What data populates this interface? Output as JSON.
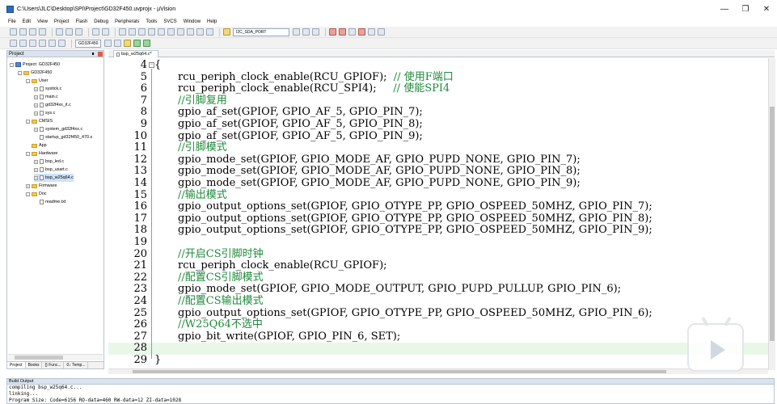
{
  "window": {
    "title": "C:\\Users\\JLC\\Desktop\\SPI\\Project\\GD32F450.uvprojx - µVision"
  },
  "menu": [
    "File",
    "Edit",
    "View",
    "Project",
    "Flash",
    "Debug",
    "Peripherals",
    "Tools",
    "SVCS",
    "Window",
    "Help"
  ],
  "toolbar": {
    "find_combo": "I2C_SDA_PORT",
    "target_combo": "GD32F450"
  },
  "project_panel": {
    "title": "Project",
    "tree": [
      {
        "label": "Project: GD32F450",
        "depth": 0,
        "kind": "project",
        "exp": "-"
      },
      {
        "label": "GD32F450",
        "depth": 1,
        "kind": "folder",
        "exp": "-"
      },
      {
        "label": "User",
        "depth": 2,
        "kind": "folder",
        "exp": "-"
      },
      {
        "label": "systick.c",
        "depth": 3,
        "kind": "file",
        "exp": "+"
      },
      {
        "label": "main.c",
        "depth": 3,
        "kind": "file",
        "exp": "+"
      },
      {
        "label": "gd32f4xx_it.c",
        "depth": 3,
        "kind": "file",
        "exp": "+"
      },
      {
        "label": "sys.c",
        "depth": 3,
        "kind": "file",
        "exp": "+"
      },
      {
        "label": "CMSIS",
        "depth": 2,
        "kind": "folder",
        "exp": "-"
      },
      {
        "label": "system_gd32f4xx.c",
        "depth": 3,
        "kind": "file",
        "exp": "+"
      },
      {
        "label": "startup_gd32f450_470.s",
        "depth": 3,
        "kind": "file",
        "exp": ""
      },
      {
        "label": "App",
        "depth": 2,
        "kind": "folder",
        "exp": ""
      },
      {
        "label": "Hardware",
        "depth": 2,
        "kind": "folder",
        "exp": "-"
      },
      {
        "label": "bsp_led.c",
        "depth": 3,
        "kind": "file",
        "exp": "+"
      },
      {
        "label": "bsp_usart.c",
        "depth": 3,
        "kind": "file",
        "exp": "+"
      },
      {
        "label": "bsp_w25q64.c",
        "depth": 3,
        "kind": "file",
        "exp": "+",
        "selected": true
      },
      {
        "label": "Firmware",
        "depth": 2,
        "kind": "folder",
        "exp": "+"
      },
      {
        "label": "Doc",
        "depth": 2,
        "kind": "folder",
        "exp": "-"
      },
      {
        "label": "readme.txt",
        "depth": 3,
        "kind": "file",
        "exp": ""
      }
    ],
    "tabs": [
      "Project",
      "Books",
      "{} Func...",
      "0↓ Temp..."
    ]
  },
  "editor": {
    "tab_label": "bsp_w25q64.c*",
    "lines": [
      {
        "n": "4",
        "code": "{",
        "comment": "",
        "first": true
      },
      {
        "n": "5",
        "code": "rcu_periph_clock_enable(RCU_GPIOF);  ",
        "comment": "// 使用F端口"
      },
      {
        "n": "6",
        "code": "rcu_periph_clock_enable(RCU_SPI4);     ",
        "comment": "// 使能SPI4"
      },
      {
        "n": "7",
        "code": "",
        "comment": "//引脚复用"
      },
      {
        "n": "8",
        "code": "gpio_af_set(GPIOF, GPIO_AF_5, GPIO_PIN_7);",
        "comment": ""
      },
      {
        "n": "9",
        "code": "gpio_af_set(GPIOF, GPIO_AF_5, GPIO_PIN_8);",
        "comment": ""
      },
      {
        "n": "10",
        "code": "gpio_af_set(GPIOF, GPIO_AF_5, GPIO_PIN_9);",
        "comment": ""
      },
      {
        "n": "11",
        "code": "",
        "comment": "//引脚模式"
      },
      {
        "n": "12",
        "code": "gpio_mode_set(GPIOF, GPIO_MODE_AF, GPIO_PUPD_NONE, GPIO_PIN_7);",
        "comment": ""
      },
      {
        "n": "13",
        "code": "gpio_mode_set(GPIOF, GPIO_MODE_AF, GPIO_PUPD_NONE, GPIO_PIN_8);",
        "comment": ""
      },
      {
        "n": "14",
        "code": "gpio_mode_set(GPIOF, GPIO_MODE_AF, GPIO_PUPD_NONE, GPIO_PIN_9);",
        "comment": ""
      },
      {
        "n": "15",
        "code": "",
        "comment": "//输出模式"
      },
      {
        "n": "16",
        "code": "gpio_output_options_set(GPIOF, GPIO_OTYPE_PP, GPIO_OSPEED_50MHZ, GPIO_PIN_7);",
        "comment": ""
      },
      {
        "n": "17",
        "code": "gpio_output_options_set(GPIOF, GPIO_OTYPE_PP, GPIO_OSPEED_50MHZ, GPIO_PIN_8);",
        "comment": ""
      },
      {
        "n": "18",
        "code": "gpio_output_options_set(GPIOF, GPIO_OTYPE_PP, GPIO_OSPEED_50MHZ, GPIO_PIN_9);",
        "comment": ""
      },
      {
        "n": "19",
        "code": "",
        "comment": ""
      },
      {
        "n": "20",
        "code": "",
        "comment": "//开启CS引脚时钟"
      },
      {
        "n": "21",
        "code": "rcu_periph_clock_enable(RCU_GPIOF);",
        "comment": ""
      },
      {
        "n": "22",
        "code": "",
        "comment": "//配置CS引脚模式"
      },
      {
        "n": "23",
        "code": "gpio_mode_set(GPIOF, GPIO_MODE_OUTPUT, GPIO_PUPD_PULLUP, GPIO_PIN_6);",
        "comment": ""
      },
      {
        "n": "24",
        "code": "",
        "comment": "//配置CS输出模式"
      },
      {
        "n": "25",
        "code": "gpio_output_options_set(GPIOF, GPIO_OTYPE_PP, GPIO_OSPEED_50MHZ, GPIO_PIN_6);",
        "comment": ""
      },
      {
        "n": "26",
        "code": "",
        "comment": "//W25Q64不选中"
      },
      {
        "n": "27",
        "code": "gpio_bit_write(GPIOF, GPIO_PIN_6, SET);",
        "comment": ""
      },
      {
        "n": "28",
        "code": "",
        "comment": "",
        "current": true
      },
      {
        "n": "29",
        "code": "}",
        "comment": "",
        "first": true
      }
    ]
  },
  "build_output": {
    "title": "Build Output",
    "lines": [
      "compiling bsp_w25q64.c...",
      "linking...",
      "Program Size: Code=6156 RO-data=460 RW-data=12 ZI-data=1028"
    ]
  },
  "colors": {
    "comment": "#1e8a3a",
    "current_line": "#e9f7e9",
    "panel_header": "#dbe4ee"
  }
}
